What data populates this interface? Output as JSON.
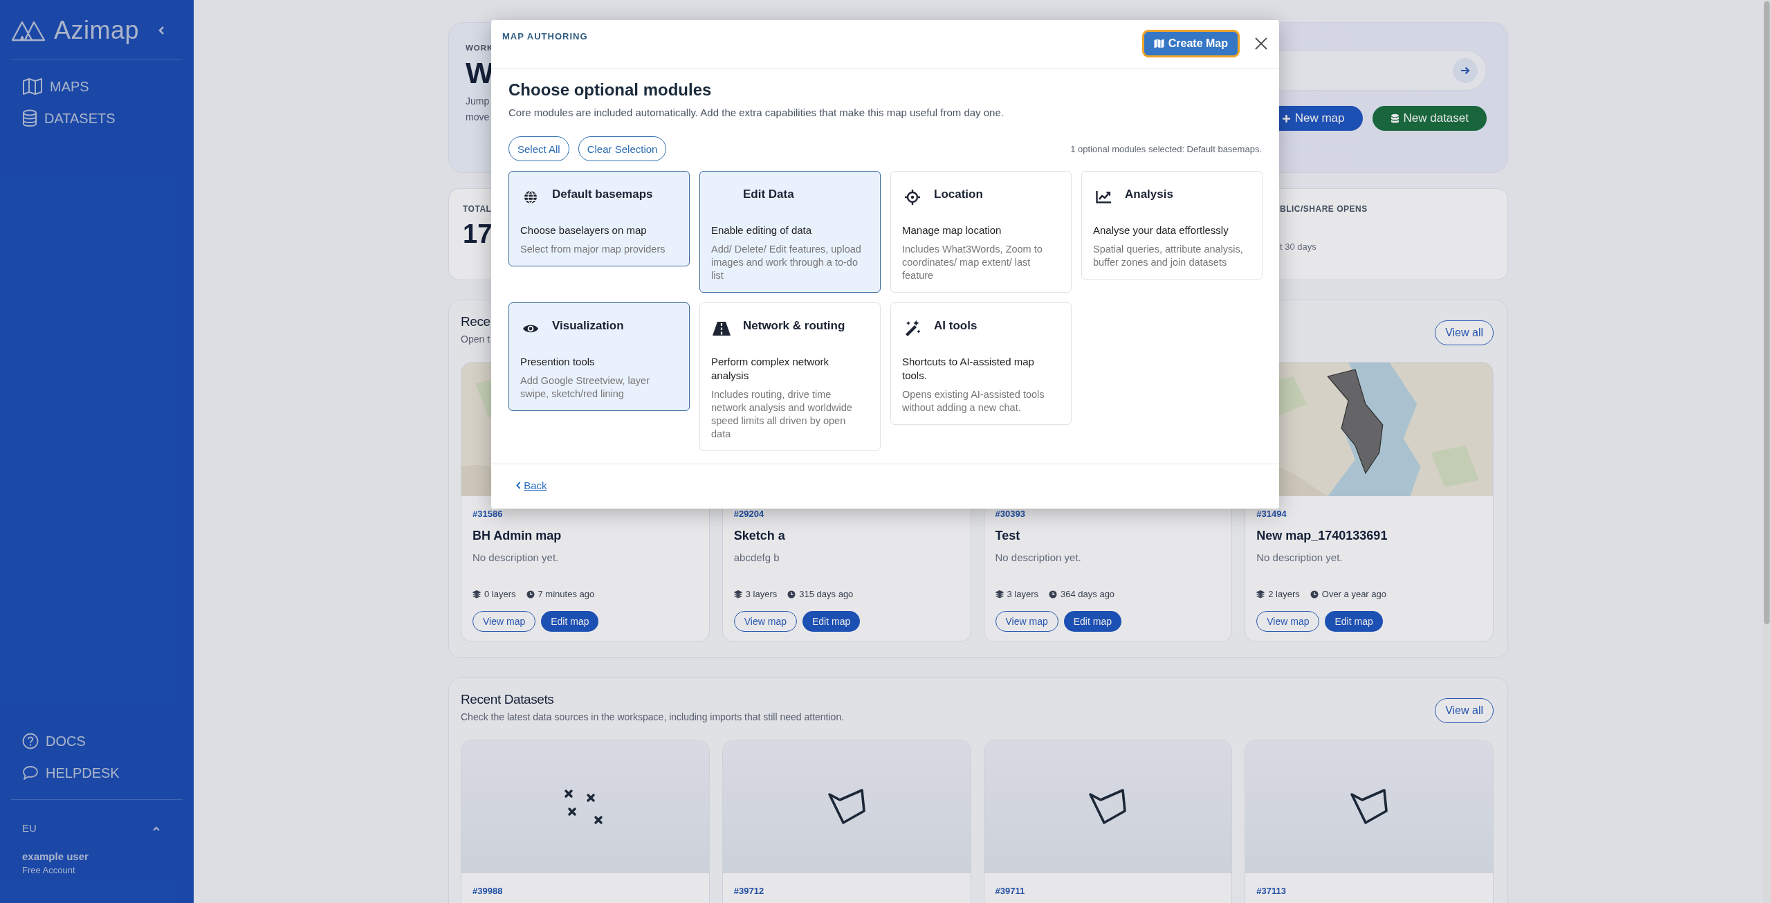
{
  "sidebar": {
    "brand": "Azimap",
    "nav": [
      "MAPS",
      "DATASETS"
    ],
    "help": [
      "DOCS",
      "HELPDESK"
    ],
    "region": "EU",
    "user": {
      "name": "example user",
      "plan": "Free Account"
    }
  },
  "hero": {
    "eyebrow": "WORK",
    "title": "W",
    "lines": [
      "Jump",
      "move"
    ],
    "actions": [
      "New map",
      "New dataset"
    ]
  },
  "stats": [
    {
      "label": "TOTAL",
      "value": "17"
    },
    {
      "label": "BLIC/SHARE OPENS",
      "note": "t 30 days"
    }
  ],
  "recent_maps": {
    "title": "Rece",
    "subtitle": "Open t",
    "view_all": "View all",
    "cards": [
      {
        "id": "#31586",
        "name": "BH Admin map",
        "description": "No description yet.",
        "layers": "0 layers",
        "updated": "7 minutes ago",
        "actions": [
          "View map",
          "Edit map"
        ]
      },
      {
        "id": "#29204",
        "name": "Sketch a",
        "description": "abcdefg b",
        "layers": "3 layers",
        "updated": "315 days ago",
        "actions": [
          "View map",
          "Edit map"
        ]
      },
      {
        "id": "#30393",
        "name": "Test",
        "description": "No description yet.",
        "layers": "3 layers",
        "updated": "364 days ago",
        "actions": [
          "View map",
          "Edit map"
        ]
      },
      {
        "id": "#31494",
        "name": "New map_1740133691",
        "description": "No description yet.",
        "layers": "2 layers",
        "updated": "Over a year ago",
        "actions": [
          "View map",
          "Edit map"
        ]
      }
    ]
  },
  "recent_datasets": {
    "title": "Recent Datasets",
    "subtitle": "Check the latest data sources in the workspace, including imports that still need attention.",
    "view_all": "View all",
    "cards": [
      {
        "id": "#39988",
        "kind": "point"
      },
      {
        "id": "#39712",
        "kind": "polygon"
      },
      {
        "id": "#39711",
        "kind": "polygon"
      },
      {
        "id": "#37113",
        "kind": "polygon"
      }
    ]
  },
  "modal": {
    "eyebrow": "MAP AUTHORING",
    "primary": {
      "label": "Create Map",
      "focused": true
    },
    "title": "Choose optional modules",
    "subtitle": "Core modules are included automatically. Add the extra capabilities that make this map useful from day one.",
    "select_all": "Select All",
    "clear": "Clear Selection",
    "summary": "1 optional modules selected: Default basemaps.",
    "modules": [
      {
        "title": "Default basemaps",
        "summary": "Choose baselayers on map",
        "detail": "Select from major map providers",
        "selected": true
      },
      {
        "title": "Edit Data",
        "summary": "Enable editing of data",
        "detail": "Add/ Delete/ Edit features, upload images and work through a to-do list",
        "selected": true
      },
      {
        "title": "Location",
        "summary": "Manage map location",
        "detail": "Includes What3Words, Zoom to coordinates/ map extent/ last feature",
        "selected": false
      },
      {
        "title": "Analysis",
        "summary": "Analyse your data effortlessly",
        "detail": "Spatial queries, attribute analysis, buffer zones and join datasets",
        "selected": false
      },
      {
        "title": "Visualization",
        "summary": "Presention tools",
        "detail": "Add Google Streetview, layer swipe, sketch/red lining",
        "selected": true
      },
      {
        "title": "Network & routing",
        "summary": "Perform complex network analysis",
        "detail": "Includes routing, drive time network analysis and worldwide speed limits all driven by open data",
        "selected": false
      },
      {
        "title": "AI tools",
        "summary": "Shortcuts to AI-assisted map tools.",
        "detail": "Opens existing AI-assisted tools without adding a new chat.",
        "selected": false
      }
    ],
    "back": "Back"
  }
}
